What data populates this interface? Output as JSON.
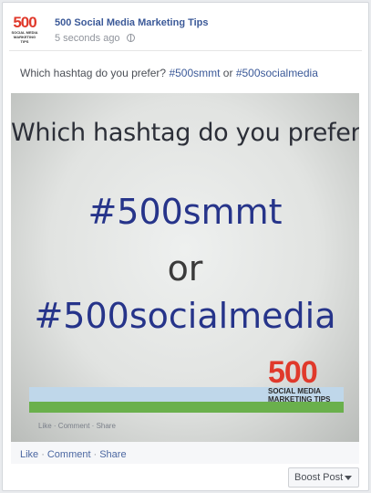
{
  "post": {
    "page_name": "500 Social Media Marketing Tips",
    "timestamp": "5 seconds ago",
    "privacy_icon": "globe-icon",
    "avatar": {
      "number": "500",
      "tagline": "SOCIAL MEDIA MARKETING TIPS"
    },
    "text_prefix": "Which hashtag do you prefer? ",
    "tag1": "#500smmt",
    "text_or": " or ",
    "tag2": "#500socialmedia"
  },
  "photo": {
    "title": "Which hashtag do you prefer?",
    "tag1": "#500smmt",
    "or": "or",
    "tag2": "#500socialmedia",
    "logo_number": "500",
    "logo_line1": "SOCIAL MEDIA",
    "logo_line2": "MARKETING TIPS",
    "inner_actions": "Like · Comment · Share"
  },
  "actions": {
    "like": "Like",
    "comment": "Comment",
    "share": "Share",
    "separator": "·"
  },
  "boost": {
    "label": "Boost Post",
    "icon": "caret-down-icon"
  },
  "colors": {
    "link": "#3b5998",
    "brand_red": "#e0392b",
    "photo_blue": "#26348a"
  }
}
